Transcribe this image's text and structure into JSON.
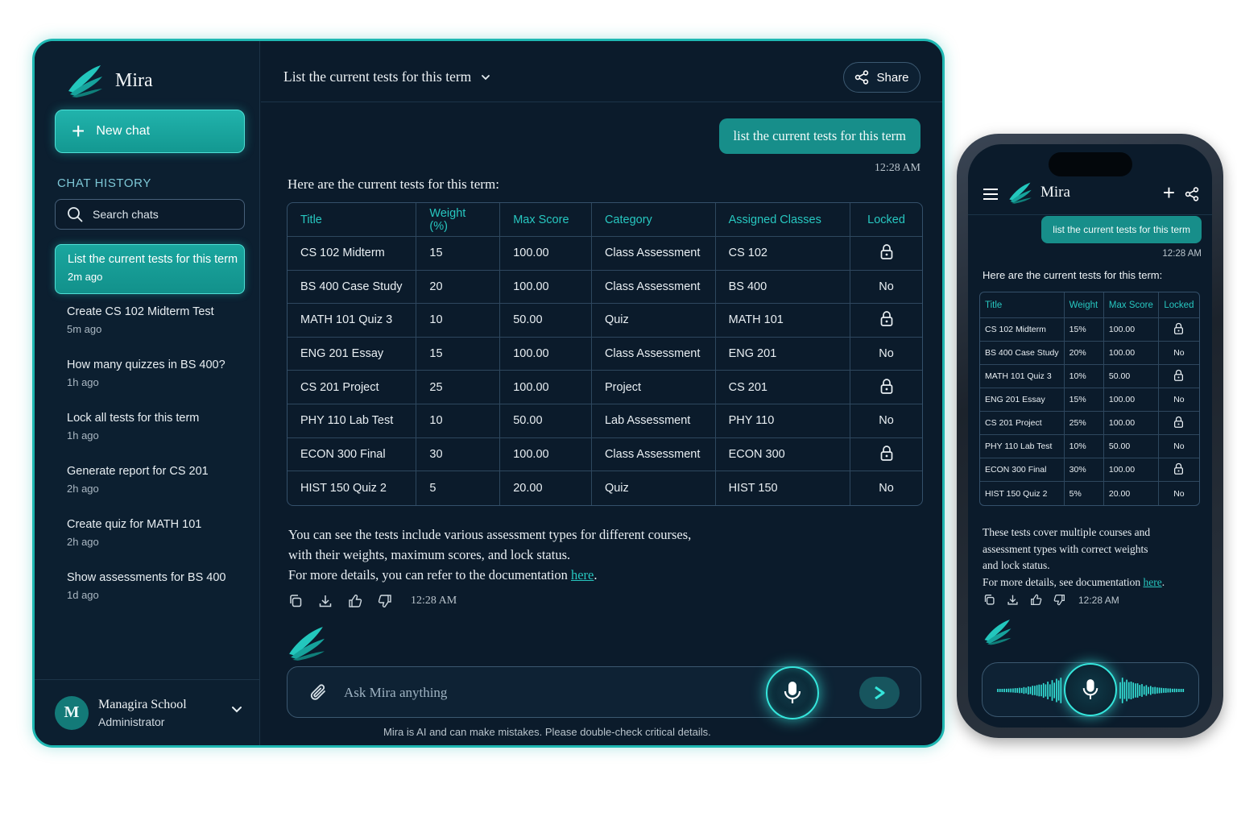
{
  "app": {
    "name": "Mira"
  },
  "sidebar": {
    "new_chat_label": "New chat",
    "history_title": "CHAT HISTORY",
    "search_placeholder": "Search chats",
    "items": [
      {
        "title": "List the current tests for this term",
        "time": "2m ago",
        "active": true
      },
      {
        "title": "Create CS 102 Midterm Test",
        "time": "5m ago"
      },
      {
        "title": "How many quizzes in BS 400?",
        "time": "1h ago"
      },
      {
        "title": "Lock all tests for this term",
        "time": "1h ago"
      },
      {
        "title": "Generate report for CS 201",
        "time": "2h ago"
      },
      {
        "title": "Create quiz for MATH 101",
        "time": "2h ago"
      },
      {
        "title": "Show assessments for BS 400",
        "time": "1d ago"
      }
    ],
    "user": {
      "initial": "M",
      "name": "Managira School",
      "role": "Administrator"
    }
  },
  "header": {
    "title": "List the current tests for this term",
    "share_label": "Share"
  },
  "chat": {
    "user_message": "list the current tests for this term",
    "user_time": "12:28 AM",
    "intro": "Here are the current tests for this term:",
    "table": {
      "headers": [
        "Title",
        "Weight (%)",
        "Max Score",
        "Category",
        "Assigned Classes",
        "Locked"
      ],
      "rows": [
        [
          "CS 102 Midterm",
          "15",
          "100.00",
          "Class Assessment",
          "CS 102",
          "lock"
        ],
        [
          "BS 400 Case Study",
          "20",
          "100.00",
          "Class Assessment",
          "BS 400",
          "No"
        ],
        [
          "MATH 101 Quiz 3",
          "10",
          "50.00",
          "Quiz",
          "MATH 101",
          "lock"
        ],
        [
          "ENG 201 Essay",
          "15",
          "100.00",
          "Class Assessment",
          "ENG 201",
          "No"
        ],
        [
          "CS 201 Project",
          "25",
          "100.00",
          "Project",
          "CS 201",
          "lock"
        ],
        [
          "PHY 110 Lab Test",
          "10",
          "50.00",
          "Lab Assessment",
          "PHY 110",
          "No"
        ],
        [
          "ECON 300 Final",
          "30",
          "100.00",
          "Class Assessment",
          "ECON 300",
          "lock"
        ],
        [
          "HIST 150 Quiz 2",
          "5",
          "20.00",
          "Quiz",
          "HIST 150",
          "No"
        ]
      ]
    },
    "desc_line1": "You can see the tests include various assessment types for different courses,",
    "desc_line2": "with their weights, maximum scores, and lock status.",
    "desc_line3_prefix": "For more details, you can refer to the documentation ",
    "link_label": "here",
    "desc_suffix": ".",
    "response_time": "12:28 AM",
    "composer_placeholder": "Ask Mira anything",
    "disclaimer": "Mira is AI and can make mistakes. Please double-check critical details."
  },
  "mobile": {
    "brand": "Mira",
    "user_message": "list the current tests for this term",
    "user_time": "12:28 AM",
    "intro": "Here are the current tests for this term:",
    "table": {
      "headers": [
        "Title",
        "Weight",
        "Max Score",
        "Locked"
      ],
      "rows": [
        [
          "CS 102 Midterm",
          "15%",
          "100.00",
          "lock"
        ],
        [
          "BS 400 Case Study",
          "20%",
          "100.00",
          "No"
        ],
        [
          "MATH 101 Quiz 3",
          "10%",
          "50.00",
          "lock"
        ],
        [
          "ENG 201 Essay",
          "15%",
          "100.00",
          "No"
        ],
        [
          "CS 201 Project",
          "25%",
          "100.00",
          "lock"
        ],
        [
          "PHY 110 Lab Test",
          "10%",
          "50.00",
          "No"
        ],
        [
          "ECON 300 Final",
          "30%",
          "100.00",
          "lock"
        ],
        [
          "HIST 150 Quiz 2",
          "5%",
          "20.00",
          "No"
        ]
      ]
    },
    "desc_line1": "These tests cover multiple courses and",
    "desc_line2": "assessment types with correct weights",
    "desc_line3": "and lock status.",
    "desc_line4_prefix": "For more details, see documentation ",
    "link_label": "here",
    "desc_suffix": ".",
    "response_time": "12:28 AM"
  },
  "colors": {
    "accent": "#1fb8b3",
    "background": "#0b1b2b",
    "header_text": "#27c7c0"
  }
}
